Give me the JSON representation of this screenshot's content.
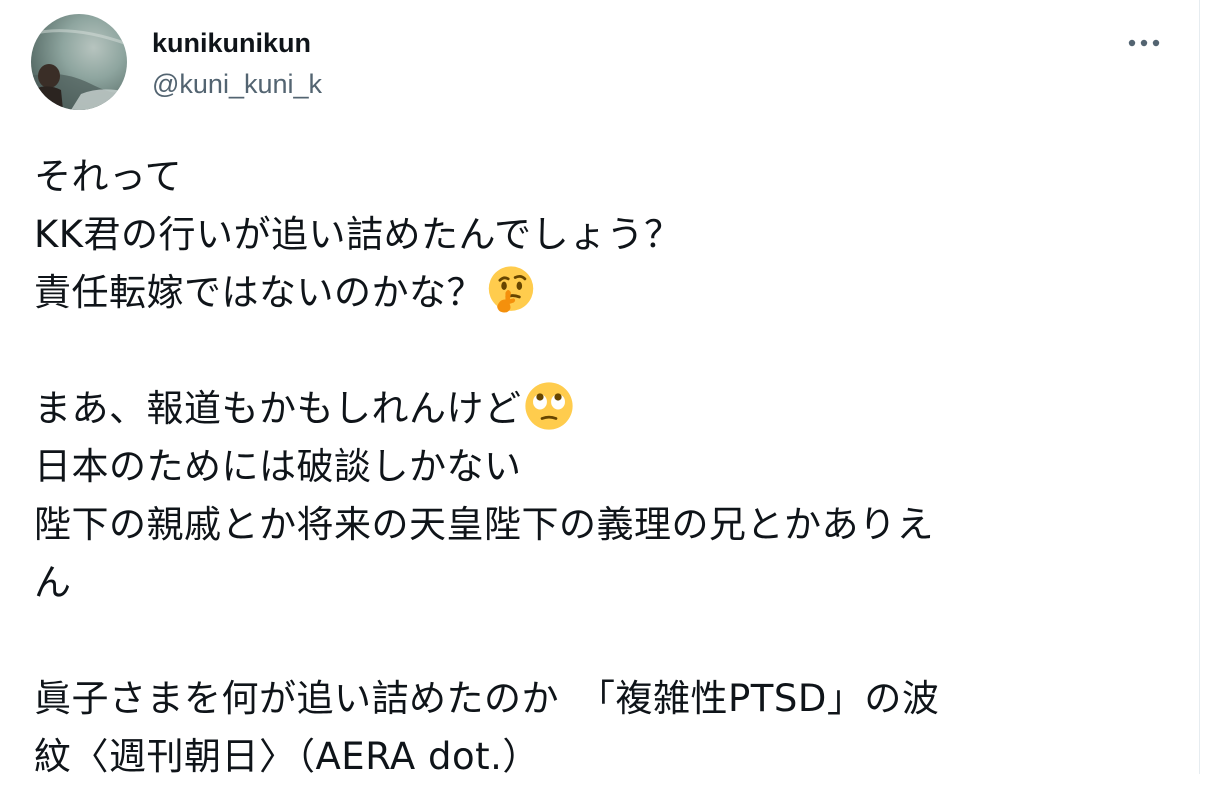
{
  "tweet": {
    "author": {
      "display_name": "kunikunikun",
      "handle": "@kuni_kuni_k",
      "avatar_icon": "profile-photo"
    },
    "more_icon": "more-horizontal-icon",
    "lines": [
      "それって",
      "KK君の行いが追い詰めたんでしょう？",
      "責任転嫁ではないのかな？",
      "まあ、報道もかもしれんけど",
      "日本のためには破談しかない",
      "陛下の親戚とか将来の天皇陛下の義理の兄とかありえ",
      "ん",
      "眞子さまを何が追い詰めたのか　「複雑性PTSD」の波",
      "紋〈週刊朝日〉（AERA dot.）"
    ],
    "emojis": {
      "thinking": "thinking-face-emoji",
      "eye_roll": "face-with-rolling-eyes-emoji"
    },
    "colors": {
      "text": "#0f1419",
      "secondary_text": "#536471",
      "border": "#e6ecf0",
      "emoji_yellow": "#ffcc4d"
    }
  }
}
